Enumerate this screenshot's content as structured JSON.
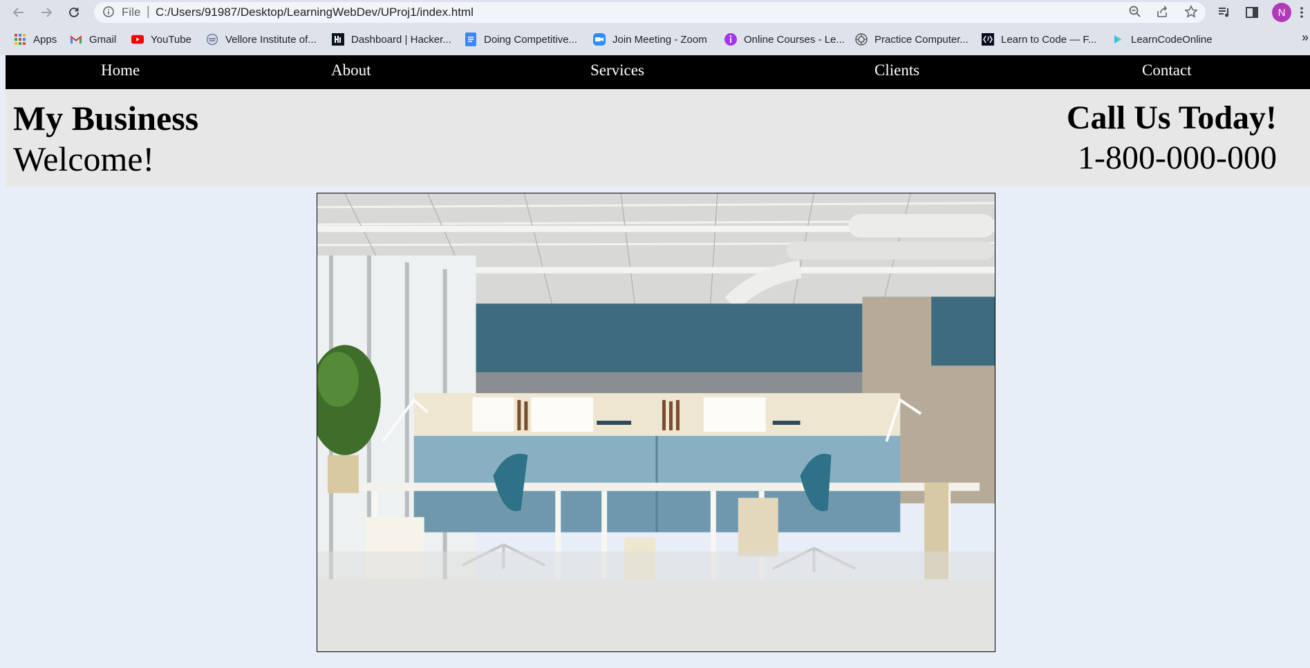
{
  "browser": {
    "scheme_label": "File",
    "url": "C:/Users/91987/Desktop/LearningWebDev/UProj1/index.html",
    "profile_initial": "N",
    "profile_color": "#b23ab8"
  },
  "bookmarks": [
    {
      "label": "Apps",
      "icon": "apps-grid-icon"
    },
    {
      "label": "Gmail",
      "icon": "gmail-icon"
    },
    {
      "label": "YouTube",
      "icon": "youtube-icon"
    },
    {
      "label": "Vellore Institute of...",
      "icon": "vit-icon"
    },
    {
      "label": "Dashboard | Hacker...",
      "icon": "hackerrank-icon"
    },
    {
      "label": "Doing Competitive...",
      "icon": "google-docs-icon"
    },
    {
      "label": "Join Meeting - Zoom",
      "icon": "zoom-icon"
    },
    {
      "label": "Online Courses - Le...",
      "icon": "online-courses-icon"
    },
    {
      "label": "Practice Computer...",
      "icon": "practice-icon"
    },
    {
      "label": "Learn to Code — F...",
      "icon": "freecodecamp-icon"
    },
    {
      "label": "LearnCodeOnline",
      "icon": "learncodeonline-icon"
    }
  ],
  "site": {
    "nav": [
      "Home",
      "About",
      "Services",
      "Clients",
      "Contact"
    ],
    "title": "My Business",
    "subtitle": "Welcome!",
    "cta": "Call Us Today!",
    "phone": "1-800-000-000"
  }
}
